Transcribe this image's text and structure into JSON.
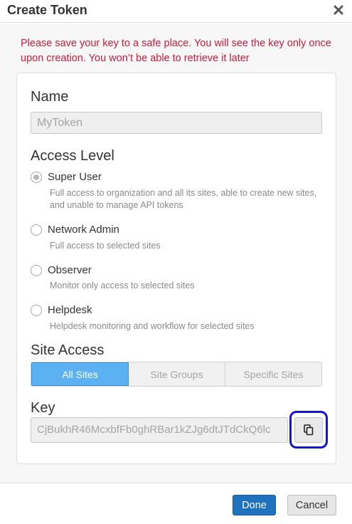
{
  "dialog": {
    "title": "Create Token",
    "close_icon": "close-icon"
  },
  "warning": "Please save your key to a safe place. You will see the key only once upon creation. You won’t be able to retrieve it later",
  "name_section": {
    "label": "Name",
    "value": "MyToken"
  },
  "access_level": {
    "label": "Access Level",
    "options": [
      {
        "label": "Super User",
        "description": "Full access to organization and all its sites, able to create new sites, and unable to manage API tokens",
        "checked": true
      },
      {
        "label": "Network Admin",
        "description": "Full access to selected sites",
        "checked": false
      },
      {
        "label": "Observer",
        "description": "Monitor only access to selected sites",
        "checked": false
      },
      {
        "label": "Helpdesk",
        "description": "Helpdesk monitoring and workflow for selected sites",
        "checked": false
      }
    ]
  },
  "site_access": {
    "label": "Site Access",
    "options": [
      "All Sites",
      "Site Groups",
      "Specific Sites"
    ],
    "selected": "All Sites"
  },
  "key_section": {
    "label": "Key",
    "value": "CjBukhR46McxbfFb0ghRBar1kZJg6dtJTdCkQ6lc",
    "copy_icon": "copy-icon"
  },
  "footer": {
    "done_label": "Done",
    "cancel_label": "Cancel"
  },
  "colors": {
    "warning": "#cc1a3a",
    "primary": "#1f72be",
    "segment_active": "#5bb1f1",
    "highlight_ring": "#1414c8"
  }
}
